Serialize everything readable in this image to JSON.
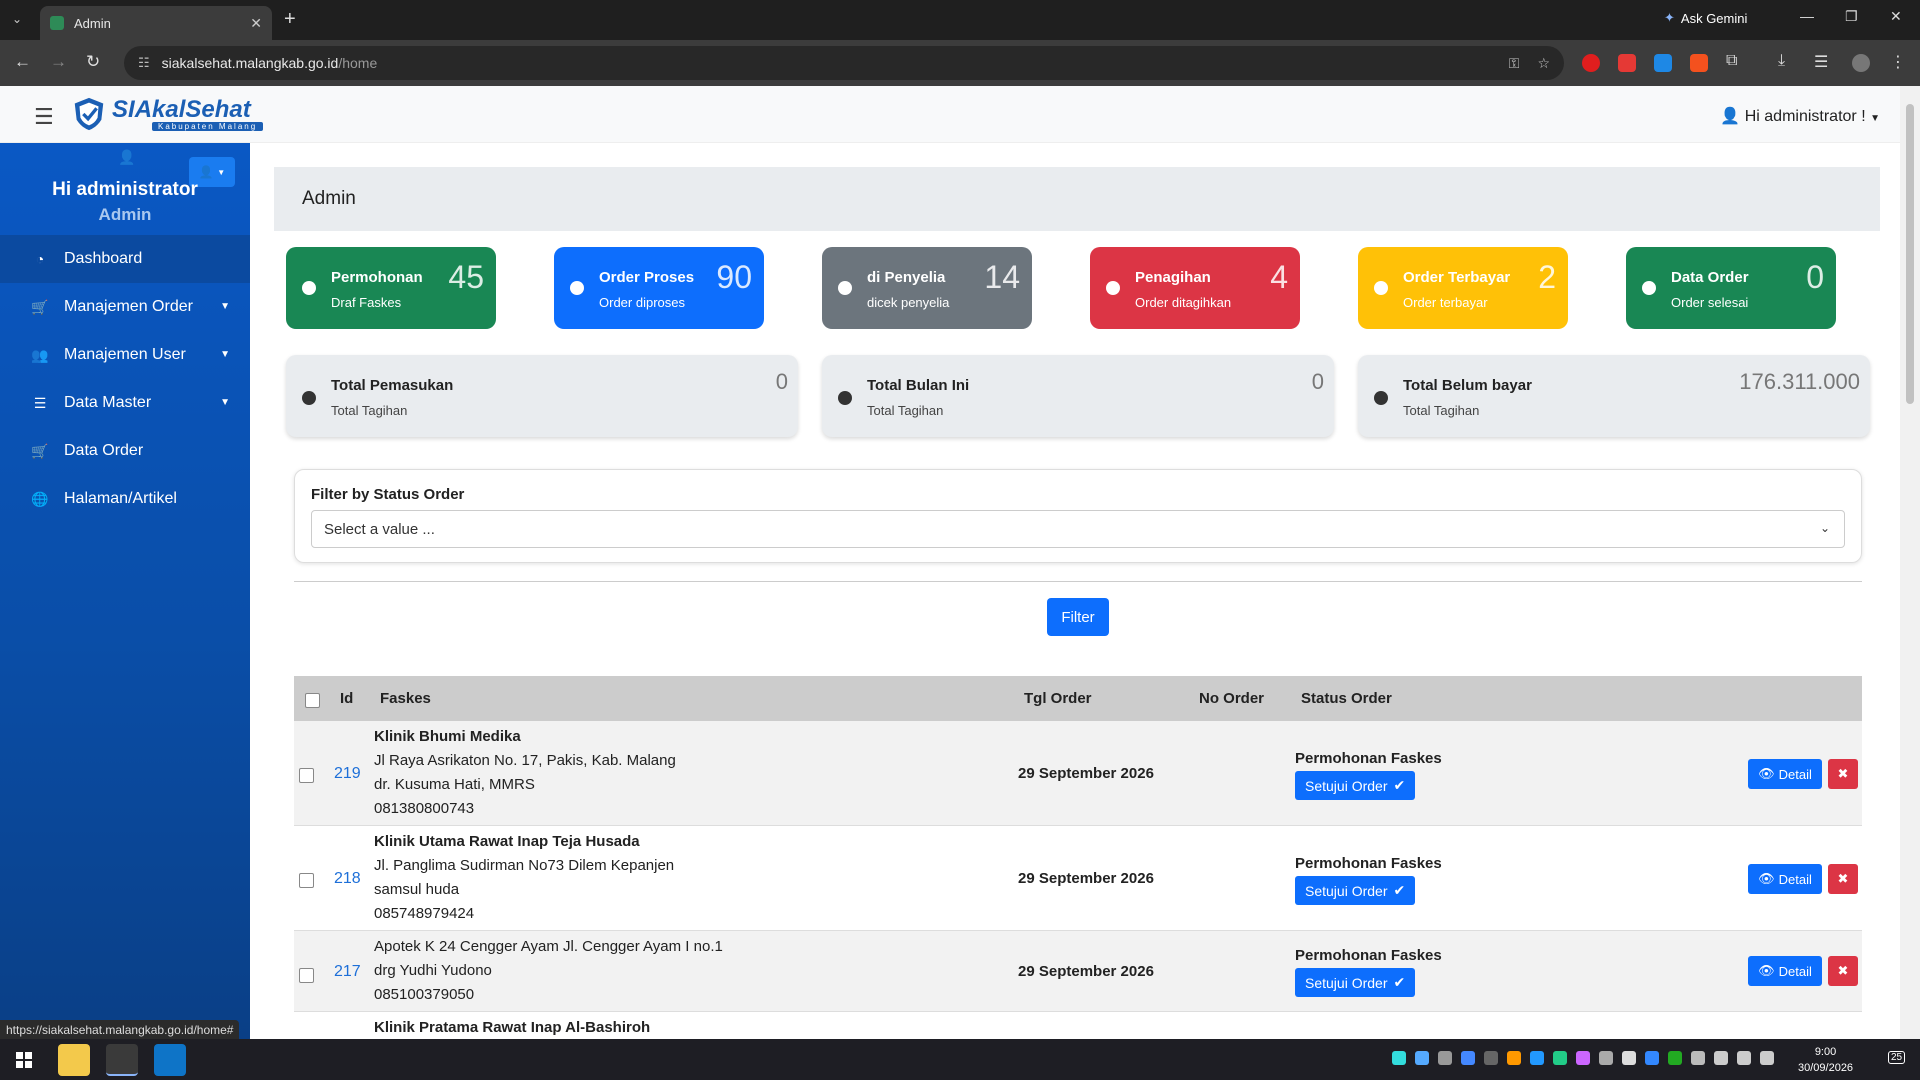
{
  "browser": {
    "tab_title": "Admin",
    "url_host": "siakalsehat.malangkab.go.id",
    "url_path": "/home",
    "ask_gemini": "Ask Gemini",
    "status_url": "https://siakalsehat.malangkab.go.id/home#"
  },
  "header": {
    "brand_si": "SI",
    "brand_name": "AkalSehat",
    "brand_sub": "Kabupaten Malang",
    "user_greeting": "Hi administrator !"
  },
  "sidebar": {
    "hi": "Hi administrator",
    "role": "Admin",
    "items": [
      {
        "label": "Dashboard",
        "icon": "dashboard-icon"
      },
      {
        "label": "Manajemen Order",
        "icon": "cart-icon"
      },
      {
        "label": "Manajemen User",
        "icon": "users-icon"
      },
      {
        "label": "Data Master",
        "icon": "list-icon"
      },
      {
        "label": "Data Order",
        "icon": "cart-icon"
      },
      {
        "label": "Halaman/Artikel",
        "icon": "globe-icon"
      }
    ]
  },
  "page": {
    "title": "Admin"
  },
  "stats": [
    {
      "title": "Permohonan",
      "sub": "Draf Faskes",
      "value": "45",
      "color": "#198754"
    },
    {
      "title": "Order Proses",
      "sub": "Order diproses",
      "value": "90",
      "color": "#0d6efd"
    },
    {
      "title": "di Penyelia",
      "sub": "dicek penyelia",
      "value": "14",
      "color": "#6c757d"
    },
    {
      "title": "Penagihan",
      "sub": "Order ditagihkan",
      "value": "4",
      "color": "#dc3545"
    },
    {
      "title": "Order Terbayar",
      "sub": "Order terbayar",
      "value": "2",
      "color": "#ffc107"
    },
    {
      "title": "Data Order",
      "sub": "Order selesai",
      "value": "0",
      "color": "#198754"
    }
  ],
  "totals": [
    {
      "title": "Total Pemasukan",
      "sub": "Total Tagihan",
      "value": "0"
    },
    {
      "title": "Total Bulan Ini",
      "sub": "Total Tagihan",
      "value": "0"
    },
    {
      "title": "Total Belum bayar",
      "sub": "Total Tagihan",
      "value": "176.311.000"
    }
  ],
  "filter": {
    "label": "Filter by Status Order",
    "placeholder": "Select a value ...",
    "button": "Filter"
  },
  "table": {
    "headers": {
      "id": "Id",
      "faskes": "Faskes",
      "tgl": "Tgl Order",
      "no": "No Order",
      "status": "Status Order"
    },
    "approve_label": "Setujui Order",
    "detail_label": "Detail",
    "rows": [
      {
        "id": "219",
        "name": "Klinik Bhumi Medika",
        "lines": [
          "Jl Raya Asrikaton No. 17, Pakis, Kab. Malang",
          "dr. Kusuma Hati, MMRS",
          "081380800743"
        ],
        "date": "29 September 2026",
        "status": "Permohonan Faskes"
      },
      {
        "id": "218",
        "name": "Klinik Utama Rawat Inap Teja Husada",
        "lines": [
          "Jl. Panglima Sudirman No73 Dilem Kepanjen",
          "samsul huda",
          "085748979424"
        ],
        "date": "29 September 2026",
        "status": "Permohonan Faskes"
      },
      {
        "id": "217",
        "name": "",
        "lines": [
          "Apotek K 24 Cengger Ayam Jl. Cengger Ayam I no.1",
          "drg Yudhi Yudono",
          "085100379050"
        ],
        "date": "29 September 2026",
        "status": "Permohonan Faskes"
      },
      {
        "id": "",
        "name": "Klinik Pratama Rawat Inap Al-Bashiroh",
        "lines": [],
        "date": "",
        "status": ""
      }
    ]
  },
  "taskbar": {
    "time": "9:00",
    "date": "30/09/2026",
    "notif": "25"
  }
}
